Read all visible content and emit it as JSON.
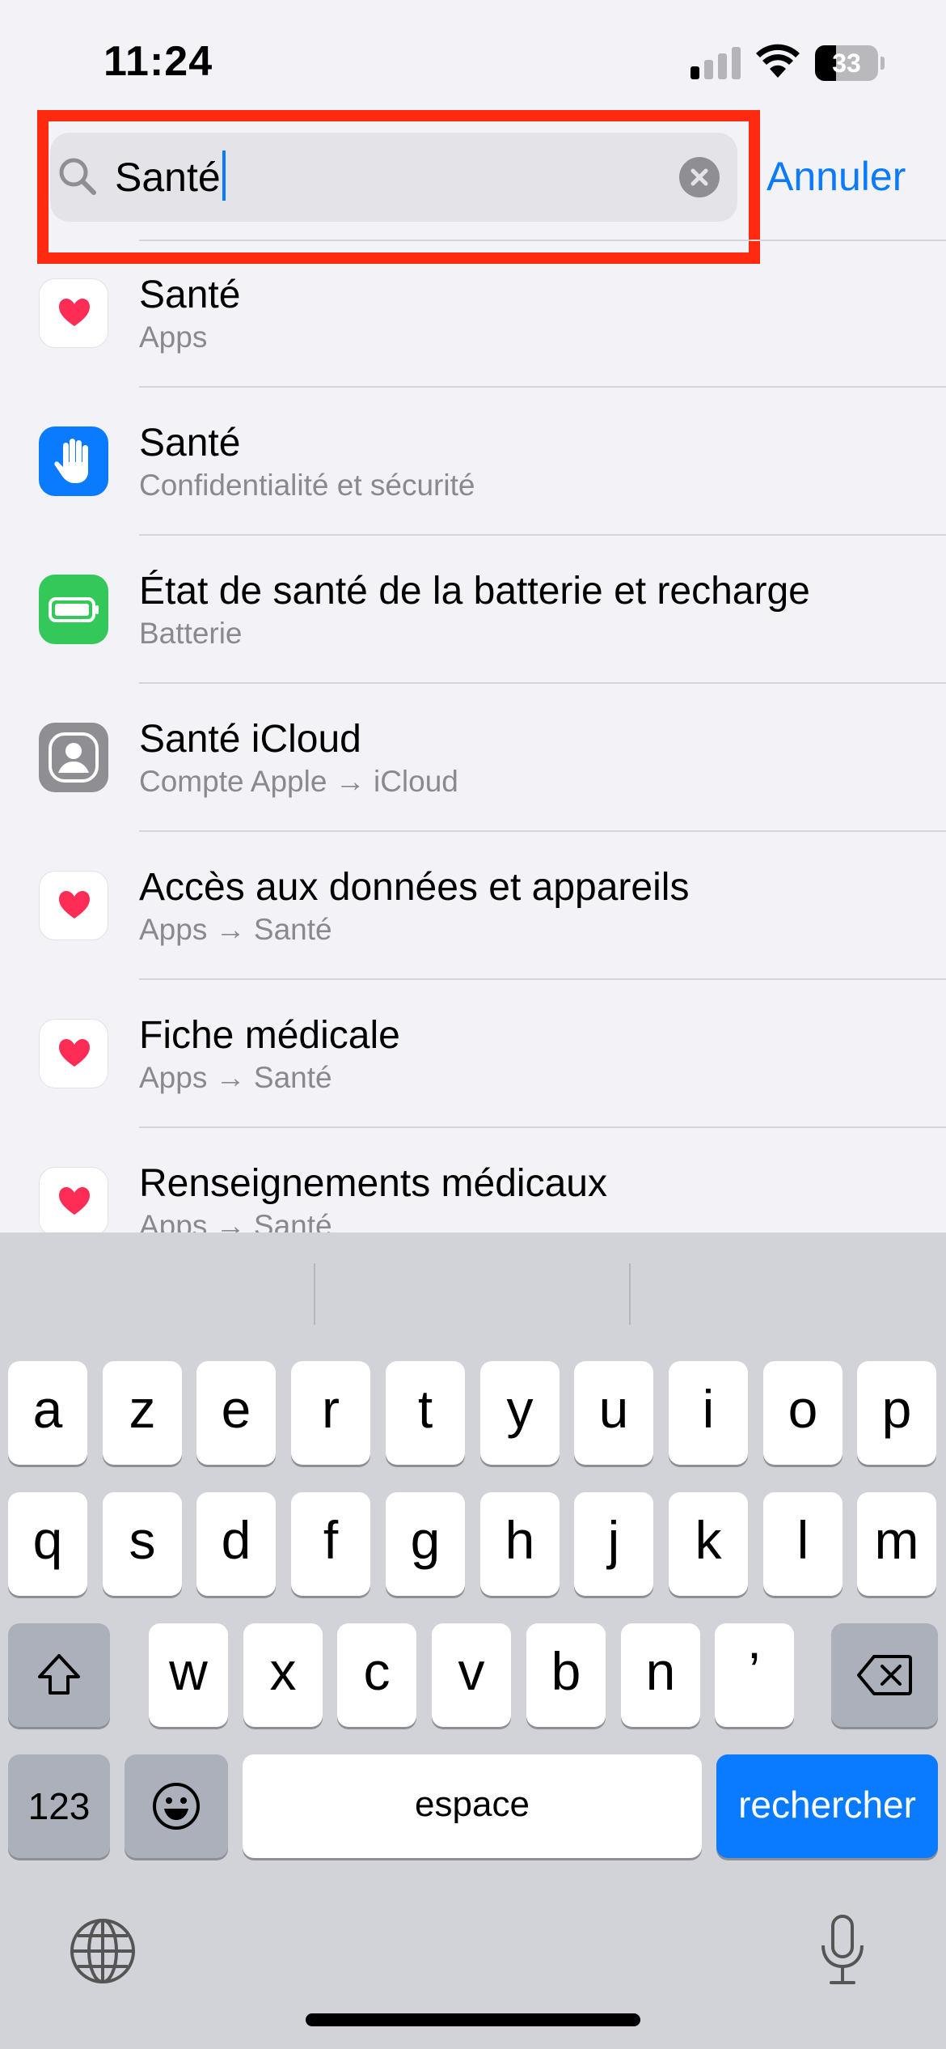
{
  "status_bar": {
    "time": "11:24",
    "battery_level": "33",
    "battery_fraction": 0.33,
    "signal_bars_active": 1,
    "signal_bars_total": 4
  },
  "search": {
    "query": "Santé",
    "cancel_label": "Annuler",
    "highlight_color": "#ff2a10"
  },
  "results": [
    {
      "title": "Santé",
      "subtitle": "Apps",
      "icon": "heart-icon",
      "icon_bg": "#ffffff"
    },
    {
      "title": "Santé",
      "subtitle": "Confidentialité et sécurité",
      "icon": "hand-icon",
      "icon_bg": "#0a7aff"
    },
    {
      "title": "État de santé de la batterie et recharge",
      "subtitle": "Batterie",
      "icon": "battery-icon",
      "icon_bg": "#34c759"
    },
    {
      "title": "Santé iCloud",
      "subtitle": "Compte Apple → iCloud",
      "icon": "person-icon",
      "icon_bg": "#8e8e93"
    },
    {
      "title": "Accès aux données et appareils",
      "subtitle": "Apps → Santé",
      "icon": "heart-icon",
      "icon_bg": "#ffffff"
    },
    {
      "title": "Fiche médicale",
      "subtitle": "Apps → Santé",
      "icon": "heart-icon",
      "icon_bg": "#ffffff"
    },
    {
      "title": "Renseignements médicaux",
      "subtitle": "Apps → Santé",
      "icon": "heart-icon",
      "icon_bg": "#ffffff"
    }
  ],
  "keyboard": {
    "row1": [
      "a",
      "z",
      "e",
      "r",
      "t",
      "y",
      "u",
      "i",
      "o",
      "p"
    ],
    "row2": [
      "q",
      "s",
      "d",
      "f",
      "g",
      "h",
      "j",
      "k",
      "l",
      "m"
    ],
    "row3": [
      "w",
      "x",
      "c",
      "v",
      "b",
      "n",
      "’"
    ],
    "numbers_label": "123",
    "space_label": "espace",
    "search_label": "rechercher"
  },
  "colors": {
    "accent": "#0a7aff",
    "background": "#f2f2f7",
    "keyboard_bg": "#d1d3d9"
  }
}
